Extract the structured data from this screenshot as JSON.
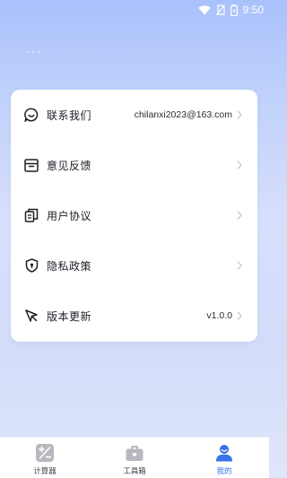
{
  "status_bar": {
    "time": "9:50",
    "icons": [
      "wifi-icon",
      "no-sim-icon",
      "battery-icon"
    ]
  },
  "settings": {
    "items": [
      {
        "label": "联系我们",
        "value": "chilanxi2023@163.com",
        "icon": "chat-bubble-icon"
      },
      {
        "label": "意见反馈",
        "value": "",
        "icon": "inbox-icon"
      },
      {
        "label": "用户协议",
        "value": "",
        "icon": "document-icon"
      },
      {
        "label": "隐私政策",
        "value": "",
        "icon": "shield-icon"
      },
      {
        "label": "版本更新",
        "value": "v1.0.0",
        "icon": "rocket-icon"
      }
    ]
  },
  "tabbar": {
    "tabs": [
      {
        "label": "计算器",
        "icon": "calculator-icon",
        "active": false
      },
      {
        "label": "工具箱",
        "icon": "toolbox-icon",
        "active": false
      },
      {
        "label": "我的",
        "icon": "user-icon",
        "active": true
      }
    ]
  },
  "colors": {
    "accent": "#3a72e8",
    "inactive_icon": "#b7b9bf",
    "background_top": "#a9c1fb",
    "background_bottom": "#dfe6fb"
  }
}
